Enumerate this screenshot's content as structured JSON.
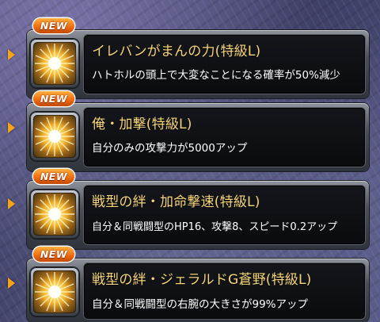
{
  "badge_label": "NEW",
  "colors": {
    "title": "#f7d67a",
    "description": "#ffffff",
    "badge": "#ee6a0e",
    "arrow": "#f4a31c"
  },
  "abilities": [
    {
      "title": "イレバンがまんの力(特級L)",
      "description": "ハトホルの頭上で大変なことになる確率が50%減少",
      "icon": "gold-sunburst-icon",
      "is_new": true
    },
    {
      "title": "俺・加撃(特級L)",
      "description": "自分のみの攻撃力が5000アップ",
      "icon": "gold-sunburst-icon",
      "is_new": true
    },
    {
      "title": "戦型の絆・加命撃速(特級L)",
      "description": "自分＆同戦闘型のHP16、攻撃8、スピード0.2アップ",
      "icon": "gold-sunburst-icon",
      "is_new": true
    },
    {
      "title": "戦型の絆・ジェラルドG蒼野(特級L)",
      "description": "自分＆同戦闘型の右腕の大きさが99%アップ",
      "icon": "gold-sunburst-icon",
      "is_new": true
    }
  ]
}
